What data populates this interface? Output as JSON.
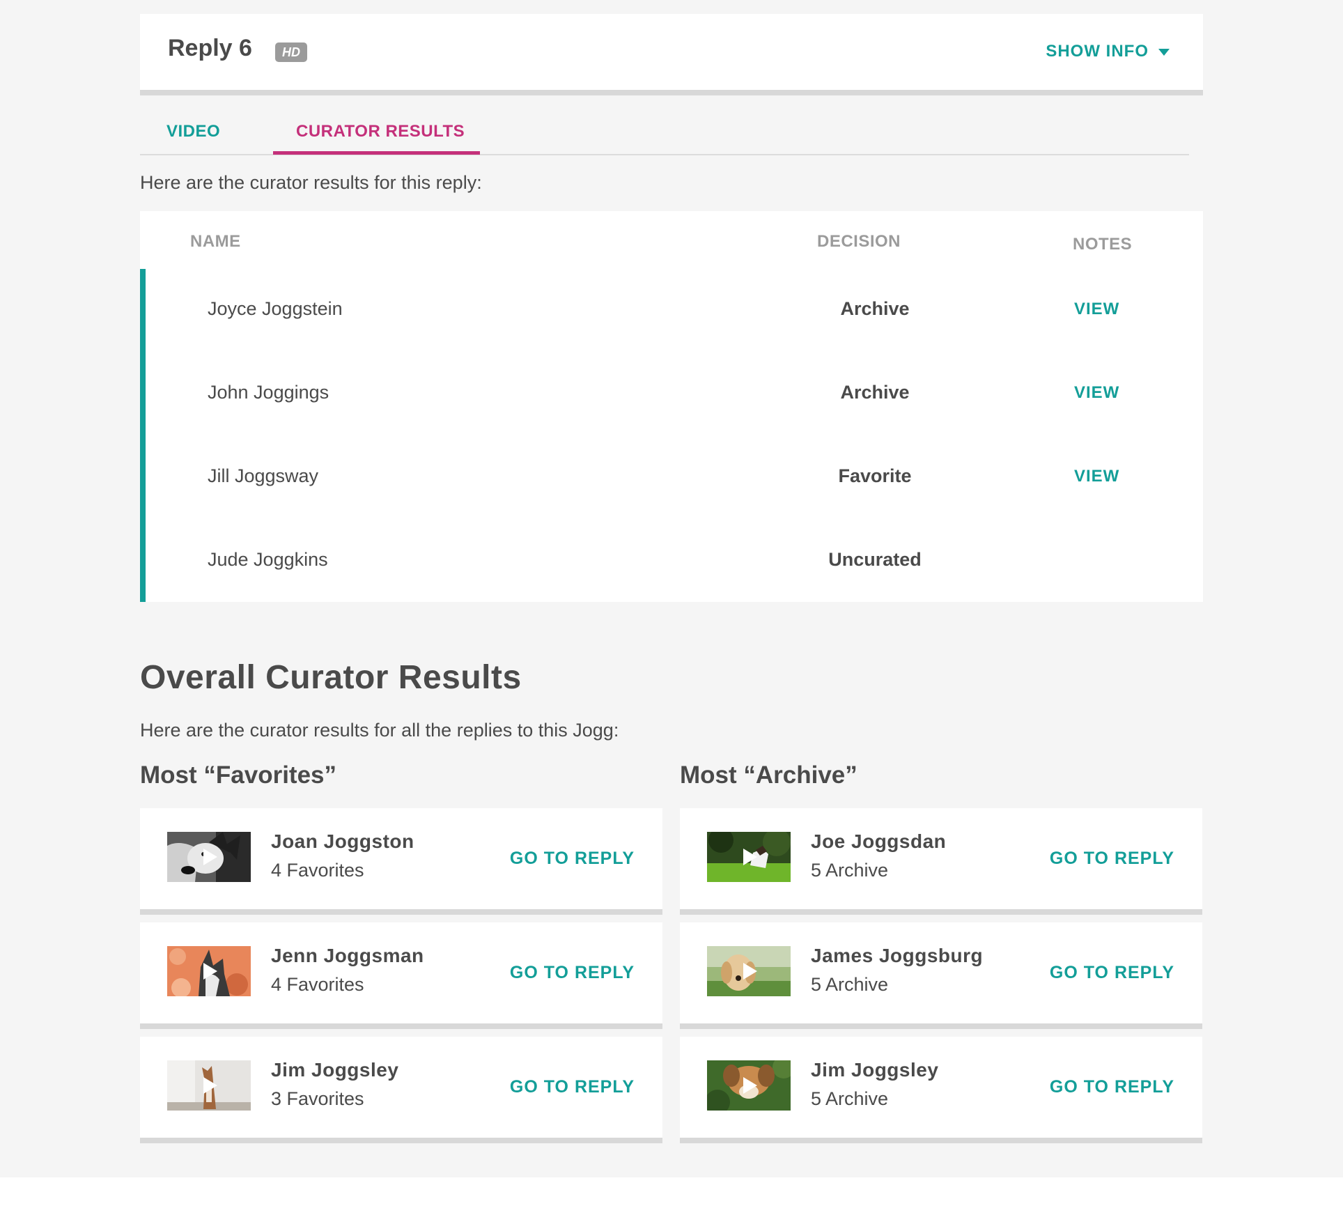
{
  "header": {
    "title": "Reply 6",
    "badge": "HD",
    "show_info": "SHOW INFO"
  },
  "tabs": [
    {
      "label": "VIDEO",
      "active": false
    },
    {
      "label": "CURATOR RESULTS",
      "active": true
    }
  ],
  "intro": "Here are the curator results for this reply:",
  "table": {
    "headers": {
      "name": "NAME",
      "decision": "DECISION",
      "notes": "NOTES"
    },
    "rows": [
      {
        "name": "Joyce Joggstein",
        "decision": "Archive",
        "notes": "VIEW"
      },
      {
        "name": "John Joggings",
        "decision": "Archive",
        "notes": "VIEW"
      },
      {
        "name": "Jill Joggsway",
        "decision": "Favorite",
        "notes": "VIEW"
      },
      {
        "name": "Jude Joggkins",
        "decision": "Uncurated",
        "notes": ""
      }
    ]
  },
  "overall": {
    "title": "Overall Curator Results",
    "subtitle": "Here are the curator results for all the replies to this Jogg:",
    "favorites": {
      "title": "Most “Favorites”",
      "items": [
        {
          "name": "Joan Joggston",
          "count": "4 Favorites",
          "action": "GO TO REPLY",
          "thumb": "husky-bw-thumbnail"
        },
        {
          "name": "Jenn Joggsman",
          "count": "4 Favorites",
          "action": "GO TO REPLY",
          "thumb": "husky-autumn-thumbnail"
        },
        {
          "name": "Jim Joggsley",
          "count": "3 Favorites",
          "action": "GO TO REPLY",
          "thumb": "dog-standing-thumbnail"
        }
      ]
    },
    "archive": {
      "title": "Most “Archive”",
      "items": [
        {
          "name": "Joe Joggsdan",
          "count": "5 Archive",
          "action": "GO TO REPLY",
          "thumb": "dog-grass-thumbnail"
        },
        {
          "name": "James Joggsburg",
          "count": "5 Archive",
          "action": "GO TO REPLY",
          "thumb": "golden-retriever-thumbnail"
        },
        {
          "name": "Jim Joggsley",
          "count": "5 Archive",
          "action": "GO TO REPLY",
          "thumb": "spaniel-grass-thumbnail"
        }
      ]
    }
  },
  "colors": {
    "accent_teal": "#139e98",
    "accent_pink": "#c4307a",
    "text": "#4a4a4a",
    "muted": "#9b9b9b",
    "background": "#f5f5f5"
  }
}
